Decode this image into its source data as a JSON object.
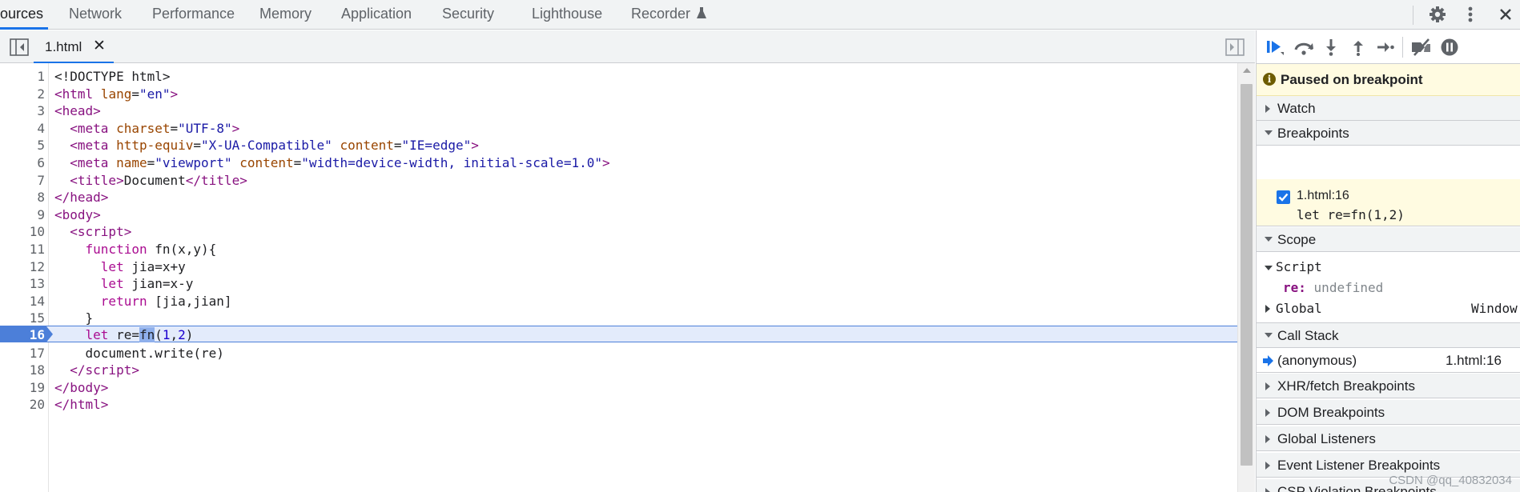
{
  "top_tabs": [
    {
      "label": "ources",
      "active": true
    },
    {
      "label": "Network"
    },
    {
      "label": "Performance"
    },
    {
      "label": "Memory"
    },
    {
      "label": "Application"
    },
    {
      "label": "Security"
    },
    {
      "label": "Lighthouse"
    },
    {
      "label": "Recorder",
      "icon": "flask-icon"
    }
  ],
  "top_icons": [
    "gear-icon",
    "kebab-menu-icon",
    "close-icon"
  ],
  "file_tab": {
    "name": "1.html",
    "close": "✕"
  },
  "editor": {
    "execution_line": 16,
    "lines": [
      "1",
      "2",
      "3",
      "4",
      "5",
      "6",
      "7",
      "8",
      "9",
      "10",
      "11",
      "12",
      "13",
      "14",
      "15",
      "16",
      "17",
      "18",
      "19",
      "20"
    ]
  },
  "debug_toolbar": [
    "resume-icon",
    "step-over-icon",
    "step-into-icon",
    "step-out-icon",
    "step-icon",
    "deactivate-breakpoints-icon",
    "pause-on-exceptions-icon"
  ],
  "sidebar": {
    "paused": "Paused on breakpoint",
    "watch": "Watch",
    "breakpoints": "Breakpoints",
    "breakpoint": {
      "file": "1.html:16",
      "code": "let re=fn(1,2)",
      "checked": true
    },
    "scope": "Scope",
    "scope_script": "Script",
    "scope_var": {
      "name": "re:",
      "value": "undefined"
    },
    "scope_global": "Global",
    "scope_global_value": "Window",
    "call_stack": "Call Stack",
    "call_frame": {
      "name": "(anonymous)",
      "location": "1.html:16"
    },
    "xhr": "XHR/fetch Breakpoints",
    "dom": "DOM Breakpoints",
    "global_listeners": "Global Listeners",
    "event_listener": "Event Listener Breakpoints",
    "csp": "CSP Violation Breakpoints"
  },
  "watermark": "CSDN @qq_40832034",
  "colors": {
    "accent": "#1a73e8",
    "paused_bg": "#fffbe1",
    "exec_line": "#e3ebfb",
    "tag": "#881280",
    "attr": "#994500",
    "value": "#1a1aa6",
    "keyword": "#aa0d91"
  }
}
